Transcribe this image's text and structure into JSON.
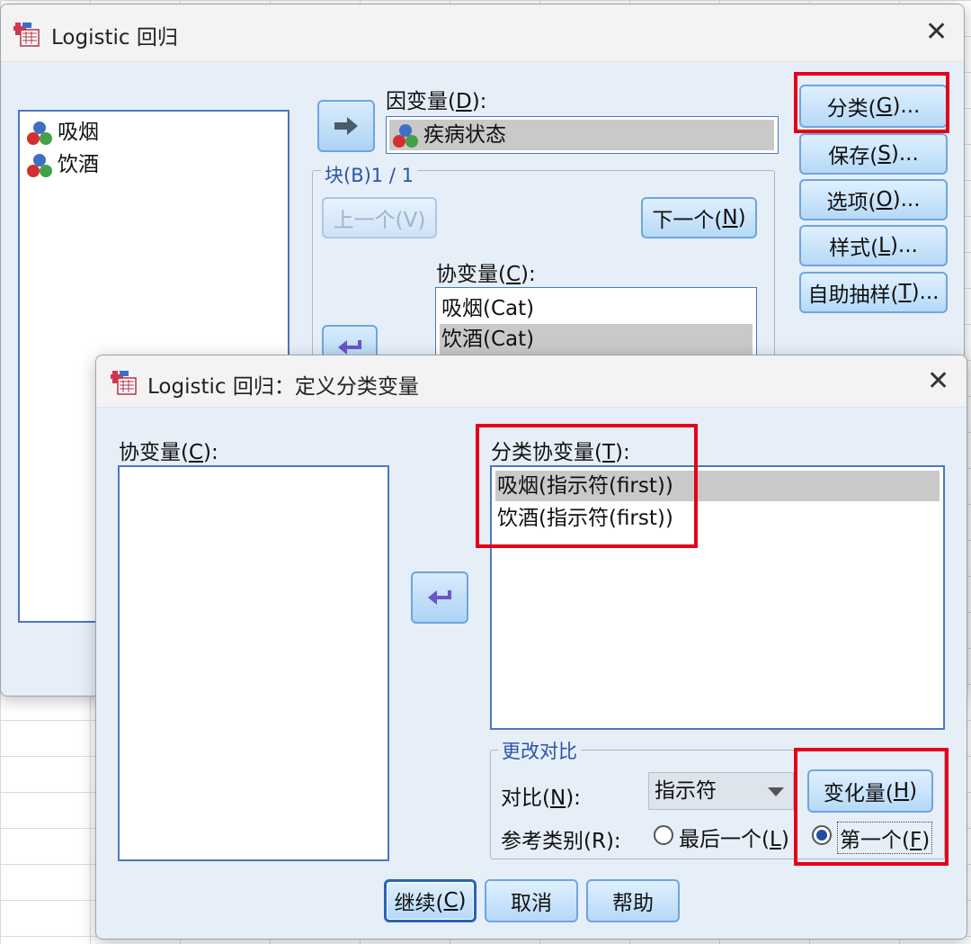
{
  "main_dialog": {
    "title": "Logistic 回归",
    "variables": [
      "吸烟",
      "饮酒"
    ],
    "dependent_label": "因变量(",
    "dependent_key": "D",
    "dependent_label_end": "):",
    "dependent_value": "疾病状态",
    "block_title": "块(B)1 / 1",
    "prev_button": "上一个(V)",
    "next_button_pre": "下一个(",
    "next_button_key": "N",
    "next_button_post": ")",
    "covariates_label_pre": "协变量(",
    "covariates_label_key": "C",
    "covariates_label_post": "):",
    "covariates": [
      "吸烟(Cat)",
      "饮酒(Cat)"
    ],
    "side_buttons": [
      {
        "pre": "分类(",
        "key": "G",
        "post": ")..."
      },
      {
        "pre": "保存(",
        "key": "S",
        "post": ")..."
      },
      {
        "pre": "选项(",
        "key": "O",
        "post": ")..."
      },
      {
        "pre": "样式(",
        "key": "L",
        "post": ")..."
      },
      {
        "pre": "自助抽样(",
        "key": "T",
        "post": ")..."
      }
    ]
  },
  "sub_dialog": {
    "title": "Logistic 回归：定义分类变量",
    "covariates_label_pre": "协变量(",
    "covariates_label_key": "C",
    "covariates_label_post": "):",
    "categorical_label_pre": "分类协变量(",
    "categorical_label_key": "T",
    "categorical_label_post": "):",
    "categorical_items": [
      "吸烟(指示符(first))",
      "饮酒(指示符(first))"
    ],
    "change_contrast_title": "更改对比",
    "contrast_label_pre": "对比(",
    "contrast_label_key": "N",
    "contrast_label_post": "):",
    "contrast_value": "指示符",
    "change_button_pre": "变化量(",
    "change_button_key": "H",
    "change_button_post": ")",
    "reference_label": "参考类别(R):",
    "ref_last_pre": "最后一个(",
    "ref_last_key": "L",
    "ref_last_post": ")",
    "ref_first_pre": "第一个(",
    "ref_first_key": "F",
    "ref_first_post": ")",
    "reference_selected": "first",
    "continue_pre": "继续(",
    "continue_key": "C",
    "continue_post": ")",
    "cancel": "取消",
    "help": "帮助"
  },
  "colors": {
    "highlight_box": "#e5001a",
    "dialog_bg": "#e6eef8",
    "button_border": "#6fa5dd"
  }
}
